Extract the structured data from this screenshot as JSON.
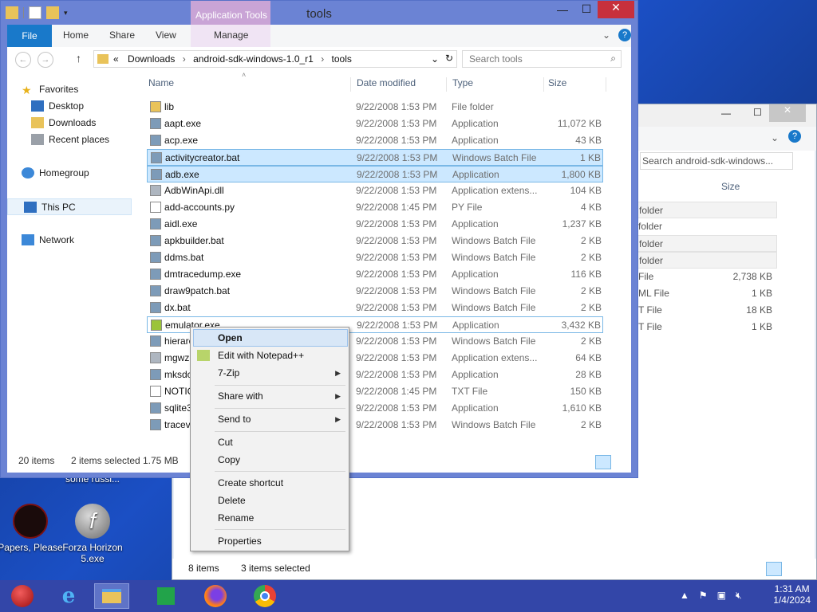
{
  "desktop": {
    "cut_text": "some russi...",
    "icons": [
      {
        "label": "Papers, Please"
      },
      {
        "label": "Forza Horizon 5.exe"
      }
    ]
  },
  "bg_window": {
    "search_placeholder": "Search android-sdk-windows...",
    "size_header": "Size",
    "rows": [
      {
        "type": "folder",
        "size": ""
      },
      {
        "type": "folder",
        "size": ""
      },
      {
        "type": "folder",
        "size": ""
      },
      {
        "type": "folder",
        "size": ""
      },
      {
        "type": "File",
        "size": "2,738 KB"
      },
      {
        "type": "ML File",
        "size": "1 KB"
      },
      {
        "type": "T File",
        "size": "18 KB"
      },
      {
        "type": "T File",
        "size": "1 KB"
      }
    ],
    "status_items": "8 items",
    "status_selected": "3 items selected"
  },
  "window": {
    "title": "tools",
    "context_tab": "Application Tools",
    "ribbon": {
      "file": "File",
      "home": "Home",
      "share": "Share",
      "view": "View",
      "manage": "Manage"
    },
    "breadcrumb": {
      "prefix": "«",
      "parts": [
        "Downloads",
        "android-sdk-windows-1.0_r1",
        "tools"
      ]
    },
    "search_placeholder": "Search tools",
    "nav": {
      "favorites": "Favorites",
      "desktop": "Desktop",
      "downloads": "Downloads",
      "recent": "Recent places",
      "homegroup": "Homegroup",
      "thispc": "This PC",
      "network": "Network"
    },
    "columns": {
      "name": "Name",
      "date": "Date modified",
      "type": "Type",
      "size": "Size"
    },
    "files": [
      {
        "name": "lib",
        "date": "9/22/2008 1:53 PM",
        "type": "File folder",
        "size": ""
      },
      {
        "name": "aapt.exe",
        "date": "9/22/2008 1:53 PM",
        "type": "Application",
        "size": "11,072 KB"
      },
      {
        "name": "acp.exe",
        "date": "9/22/2008 1:53 PM",
        "type": "Application",
        "size": "43 KB"
      },
      {
        "name": "activitycreator.bat",
        "date": "9/22/2008 1:53 PM",
        "type": "Windows Batch File",
        "size": "1 KB"
      },
      {
        "name": "adb.exe",
        "date": "9/22/2008 1:53 PM",
        "type": "Application",
        "size": "1,800 KB"
      },
      {
        "name": "AdbWinApi.dll",
        "date": "9/22/2008 1:53 PM",
        "type": "Application extens...",
        "size": "104 KB"
      },
      {
        "name": "add-accounts.py",
        "date": "9/22/2008 1:45 PM",
        "type": "PY File",
        "size": "4 KB"
      },
      {
        "name": "aidl.exe",
        "date": "9/22/2008 1:53 PM",
        "type": "Application",
        "size": "1,237 KB"
      },
      {
        "name": "apkbuilder.bat",
        "date": "9/22/2008 1:53 PM",
        "type": "Windows Batch File",
        "size": "2 KB"
      },
      {
        "name": "ddms.bat",
        "date": "9/22/2008 1:53 PM",
        "type": "Windows Batch File",
        "size": "2 KB"
      },
      {
        "name": "dmtracedump.exe",
        "date": "9/22/2008 1:53 PM",
        "type": "Application",
        "size": "116 KB"
      },
      {
        "name": "draw9patch.bat",
        "date": "9/22/2008 1:53 PM",
        "type": "Windows Batch File",
        "size": "2 KB"
      },
      {
        "name": "dx.bat",
        "date": "9/22/2008 1:53 PM",
        "type": "Windows Batch File",
        "size": "2 KB"
      },
      {
        "name": "emulator.exe",
        "date": "9/22/2008 1:53 PM",
        "type": "Application",
        "size": "3,432 KB"
      },
      {
        "name": "hierarc",
        "date": "9/22/2008 1:53 PM",
        "type": "Windows Batch File",
        "size": "2 KB"
      },
      {
        "name": "mgwz",
        "date": "9/22/2008 1:53 PM",
        "type": "Application extens...",
        "size": "64 KB"
      },
      {
        "name": "mksdc",
        "date": "9/22/2008 1:53 PM",
        "type": "Application",
        "size": "28 KB"
      },
      {
        "name": "NOTIC",
        "date": "9/22/2008 1:45 PM",
        "type": "TXT File",
        "size": "150 KB"
      },
      {
        "name": "sqlite3",
        "date": "9/22/2008 1:53 PM",
        "type": "Application",
        "size": "1,610 KB"
      },
      {
        "name": "tracev",
        "date": "9/22/2008 1:53 PM",
        "type": "Windows Batch File",
        "size": "2 KB"
      }
    ],
    "status": {
      "count": "20 items",
      "selected": "2 items selected",
      "size": "1.75 MB"
    }
  },
  "context_menu": {
    "open": "Open",
    "notepad": "Edit with Notepad++",
    "zip": "7-Zip",
    "share": "Share with",
    "send": "Send to",
    "cut": "Cut",
    "copy": "Copy",
    "shortcut": "Create shortcut",
    "delete": "Delete",
    "rename": "Rename",
    "properties": "Properties"
  },
  "taskbar": {
    "time": "1:31 AM",
    "date": "1/4/2024"
  }
}
